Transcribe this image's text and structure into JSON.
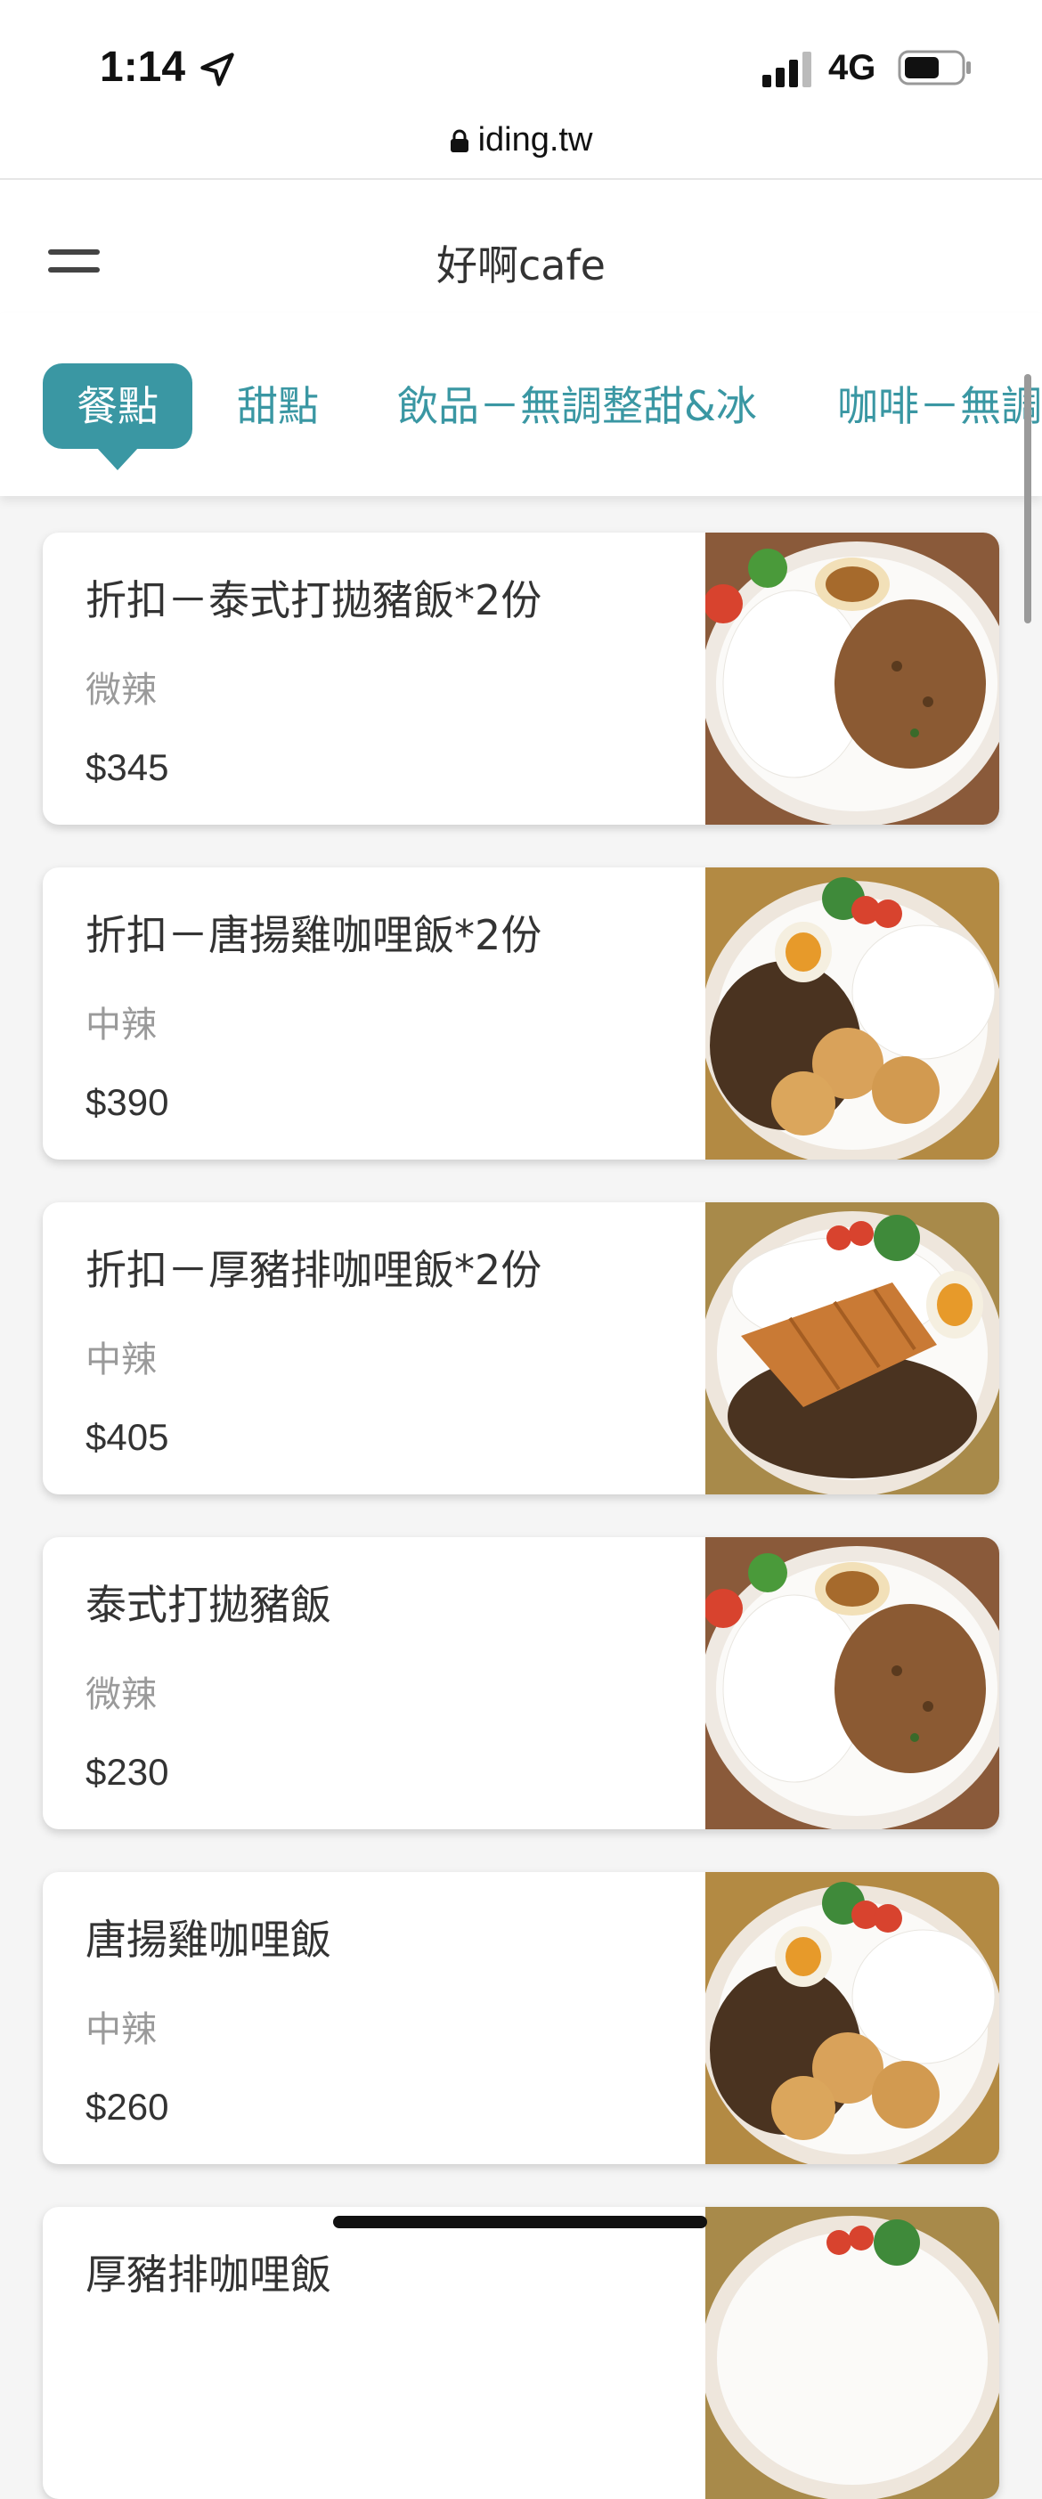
{
  "status_bar": {
    "time": "1:14",
    "network": "4G"
  },
  "browser": {
    "url": "iding.tw"
  },
  "header": {
    "title": "好啊cafe"
  },
  "tabs": [
    {
      "label": "餐點",
      "active": true
    },
    {
      "label": "甜點",
      "active": false
    },
    {
      "label": "飲品－無調整甜&冰",
      "active": false
    },
    {
      "label": "咖啡－無調整甜&冰",
      "active": false
    }
  ],
  "items": [
    {
      "name": "折扣－泰式打拋豬飯*2份",
      "spice": "微辣",
      "price": "$345",
      "image": "basil-pork-rice-photo"
    },
    {
      "name": "折扣－唐揚雞咖哩飯*2份",
      "spice": "中辣",
      "price": "$390",
      "image": "karaage-curry-rice-photo"
    },
    {
      "name": "折扣－厚豬排咖哩飯*2份",
      "spice": "中辣",
      "price": "$405",
      "image": "pork-cutlet-curry-rice-photo"
    },
    {
      "name": "泰式打拋豬飯",
      "spice": "微辣",
      "price": "$230",
      "image": "basil-pork-rice-photo"
    },
    {
      "name": "唐揚雞咖哩飯",
      "spice": "中辣",
      "price": "$260",
      "image": "karaage-curry-rice-photo"
    },
    {
      "name": "厚豬排咖哩飯",
      "spice": "",
      "price": "",
      "image": "pork-cutlet-curry-rice-photo"
    }
  ],
  "colors": {
    "accent": "#3a97a3",
    "card_bg": "#ffffff",
    "page_bg": "#f5f5f5"
  }
}
